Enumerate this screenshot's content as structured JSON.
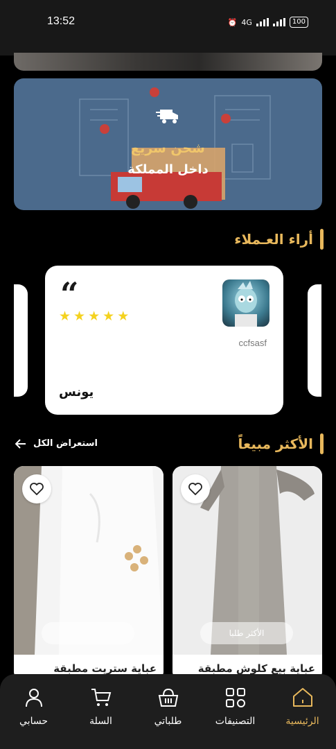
{
  "status_bar": {
    "time": "13:52",
    "network": "4G",
    "battery": "100"
  },
  "shipping_banner": {
    "title": "شحن سريع",
    "subtitle": "داخل المملكة"
  },
  "reviews": {
    "section_title": "أراء العـملاء",
    "card": {
      "quote_mark": "“",
      "rating": 5,
      "handle": "ccfsasf",
      "name": "يونس"
    }
  },
  "best_sellers": {
    "section_title": "الأكثر مبيعاً",
    "view_all_label": "استعراض الكل",
    "products": [
      {
        "name": "عباية بيع كلوش مطبقة",
        "badge": "الأكثر طلبا"
      },
      {
        "name": "عباية ستريت مطبقة",
        "badge": ""
      }
    ]
  },
  "bottom_nav": {
    "items": [
      {
        "label": "حسابي",
        "icon": "user-icon"
      },
      {
        "label": "السلة",
        "icon": "cart-icon"
      },
      {
        "label": "طلباتي",
        "icon": "basket-icon"
      },
      {
        "label": "التصنيفات",
        "icon": "grid-icon"
      },
      {
        "label": "الرئيسية",
        "icon": "home-icon"
      }
    ],
    "active": "الرئيسية"
  },
  "colors": {
    "accent": "#e8b85c",
    "banner_bg": "#4b6a8c",
    "star": "#f4d21f",
    "nav_bg": "#1e1e1e"
  }
}
